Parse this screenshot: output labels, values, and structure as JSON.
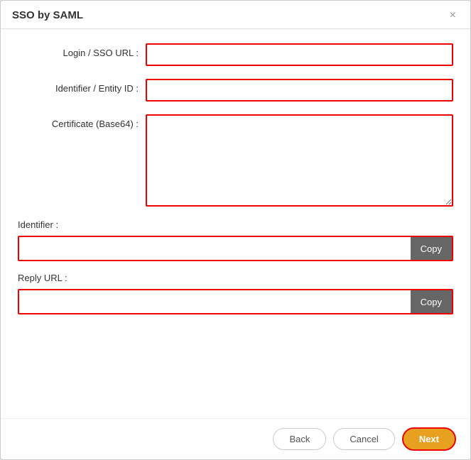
{
  "dialog": {
    "title": "SSO by SAML",
    "close_label": "×",
    "form": {
      "login_sso_url_label": "Login / SSO URL :",
      "identifier_entity_id_label": "Identifier / Entity ID :",
      "certificate_label": "Certificate (Base64) :",
      "login_sso_url_value": "",
      "identifier_entity_id_value": "",
      "certificate_value": ""
    },
    "identifier_section": {
      "label": "Identifier :",
      "value": "",
      "copy_button": "Copy"
    },
    "reply_url_section": {
      "label": "Reply URL :",
      "value": "",
      "copy_button": "Copy"
    },
    "footer": {
      "back_label": "Back",
      "cancel_label": "Cancel",
      "next_label": "Next"
    }
  }
}
